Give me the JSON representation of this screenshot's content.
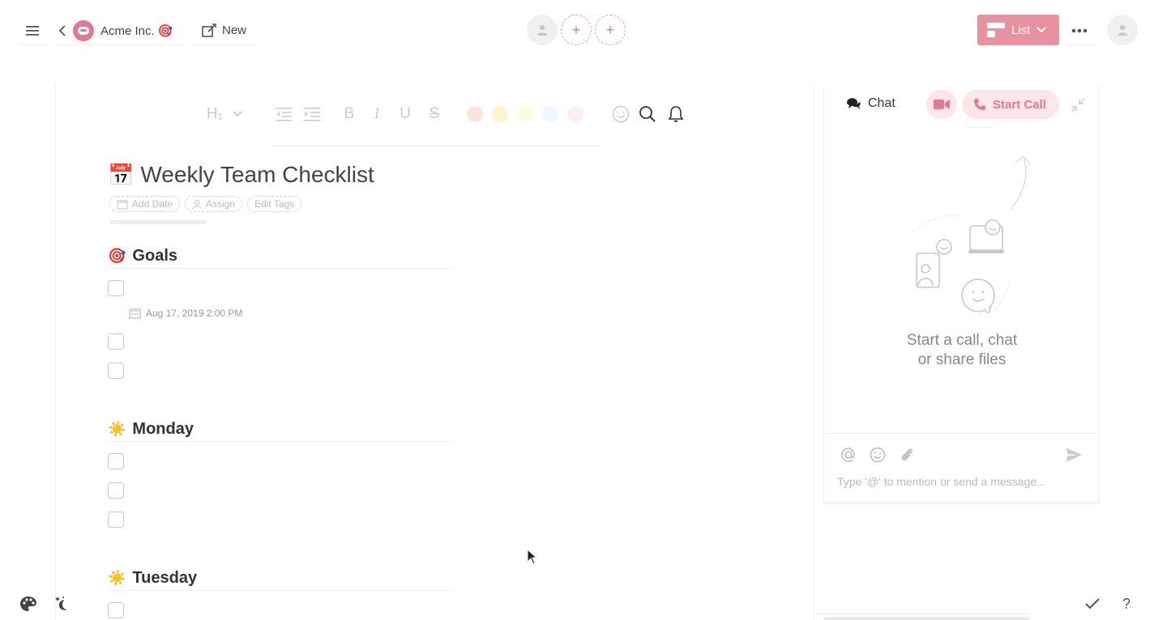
{
  "header": {
    "workspace_name": "Acme Inc. 🎯",
    "new_label": "New",
    "view_label": "List"
  },
  "colors": {
    "accent": "#e8929f",
    "accent_light": "#fbe7ea",
    "accent_text": "#e07a8f"
  },
  "toolbar": {
    "heading_label": "H₁",
    "bold": "B",
    "italic": "I",
    "underline": "U",
    "strike": "S",
    "color_swatches": [
      "#fde2e4",
      "#fff5cc",
      "#fffbe0",
      "#eef6ff",
      "#fbeef8"
    ]
  },
  "document": {
    "icon": "📅",
    "title": "Weekly Team Checklist",
    "meta": {
      "add_date": "Add Date",
      "assign": "Assign",
      "edit_tags": "Edit Tags"
    },
    "sections": [
      {
        "icon": "🎯",
        "title": "Goals"
      },
      {
        "icon": "☀️",
        "title": "Monday"
      },
      {
        "icon": "☀️",
        "title": "Tuesday"
      }
    ],
    "goals_due_date": "Aug 17, 2019 2:00 PM"
  },
  "chat": {
    "tab_label": "Chat",
    "start_call_label": "Start Call",
    "empty_line1": "Start a call, chat",
    "empty_line2": "or share files",
    "input_placeholder": "Type '@' to mention or send a message...",
    "input_value": ""
  },
  "icons": {
    "menu": "hamburger-icon",
    "back": "chevron-left-icon",
    "new": "compose-icon",
    "more": "ellipsis-icon",
    "search": "search-icon",
    "bell": "bell-icon",
    "emoji": "smiley-icon",
    "send": "send-icon",
    "attach": "paperclip-icon",
    "mention": "at-icon",
    "theme": "palette-icon",
    "dark_mode": "moon-icon",
    "done": "check-icon",
    "help": "question-icon"
  },
  "footer": {
    "help_label": "?"
  }
}
